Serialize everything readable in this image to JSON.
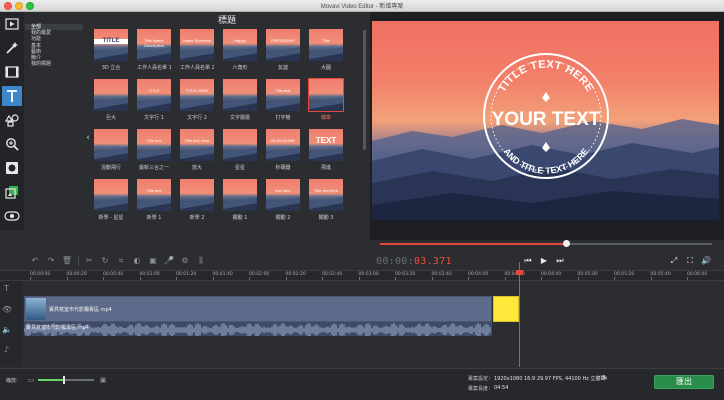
{
  "window": {
    "title": "Movavi Video Editor - 新增專案"
  },
  "categories": {
    "items": [
      {
        "label": "全部",
        "selected": true
      },
      {
        "label": "我的最愛",
        "selected": false
      },
      {
        "label": "功能",
        "selected": false
      },
      {
        "label": "基本",
        "selected": false
      },
      {
        "label": "藝術",
        "selected": false
      },
      {
        "label": "簡介",
        "selected": false
      },
      {
        "label": "我的標題",
        "selected": false
      }
    ]
  },
  "gallery": {
    "heading": "標題",
    "tiles": [
      {
        "thumb": "TITLE",
        "label": "3D 立合"
      },
      {
        "thumb": "Title Name Description",
        "label": "工作人員名單 1"
      },
      {
        "thumb": "Name Surname",
        "label": "工作人員名單 2"
      },
      {
        "thumb": "Happy",
        "label": "六角形"
      },
      {
        "thumb": "FRIENDSHIP",
        "label": "友誼"
      },
      {
        "thumb": "Title",
        "label": "大圓"
      },
      {
        "thumb": "",
        "label": "巨大"
      },
      {
        "thumb": "TITLE",
        "label": "文字行 1"
      },
      {
        "thumb": "TITLE HERE",
        "label": "文字行 2"
      },
      {
        "thumb": "",
        "label": "文字層層"
      },
      {
        "thumb": "Title text",
        "label": "打字機"
      },
      {
        "thumb": "",
        "label": "徽章"
      },
      {
        "thumb": "",
        "label": "混動飛行"
      },
      {
        "thumb": "Title text",
        "label": "最新三合之一"
      },
      {
        "thumb": "Title text Here",
        "label": "放大"
      },
      {
        "thumb": "",
        "label": "星星"
      },
      {
        "thumb": "00:00:02:986",
        "label": "秒碼器"
      },
      {
        "thumb": "TEXT",
        "label": "飛進"
      },
      {
        "thumb": "",
        "label": "新學 - 星星"
      },
      {
        "thumb": "Title text",
        "label": "新學 1"
      },
      {
        "thumb": "",
        "label": "新學 2"
      },
      {
        "thumb": "",
        "label": "獨動 1"
      },
      {
        "thumb": "text here",
        "label": "獨動 2"
      },
      {
        "thumb": "Title text here",
        "label": "獨動 3"
      }
    ]
  },
  "preview": {
    "emblem_top": "TITLE TEXT HERE",
    "emblem_main": "YOUR TEXT",
    "emblem_bottom": "AND TITLE TEXT HERE",
    "progress": 0.56
  },
  "transport": {
    "timecode_dim": "00:00:",
    "timecode_red": "03.371"
  },
  "ruler": {
    "labels": [
      "00:00:00",
      "00:00:20",
      "00:00:40",
      "00:01:00",
      "00:01:20",
      "00:01:40",
      "00:02:00",
      "00:02:20",
      "00:02:40",
      "00:03:00",
      "00:03:20",
      "00:03:40",
      "00:04:00",
      "00:04:20",
      "00:04:40",
      "00:05:00",
      "00:05:20",
      "00:05:40",
      "00:06:00"
    ]
  },
  "timeline": {
    "video_clip": "寶貝寫室市代影獨專區.mp4",
    "audio_clip": "寶貝寫室市代影獨專區.mp4"
  },
  "bottom": {
    "zoom_label": "縮放:",
    "zoom_level": 0.45,
    "settings_key": "專案設定：",
    "settings_val": "1920x1080 16:9 29.97 FPS, 44100 Hz 立體聲",
    "duration_key": "專案長度：",
    "duration_val": "04:54",
    "export_label": "匯出"
  },
  "colors": {
    "accent": "#e7463a",
    "export": "#2a8c4a",
    "title_clip": "#ffe83a",
    "active_tool": "#3d87c8"
  }
}
